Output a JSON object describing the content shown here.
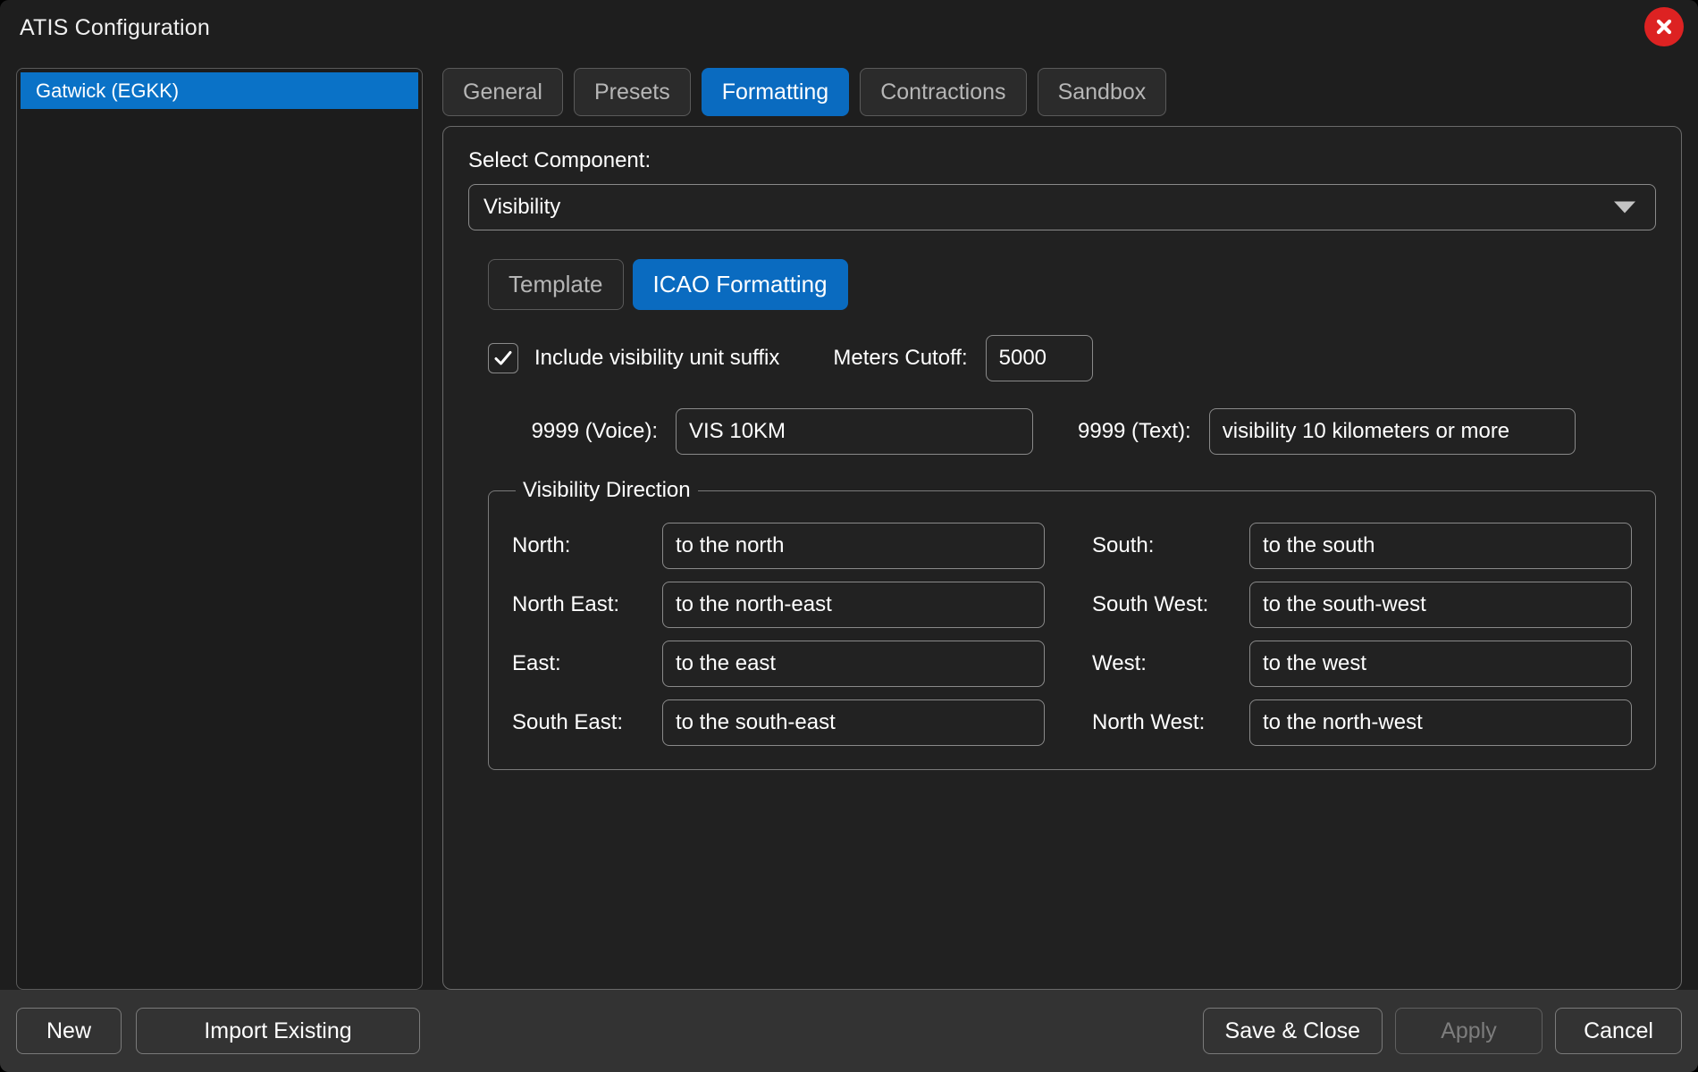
{
  "window": {
    "title": "ATIS Configuration",
    "close_icon": "close-circle-icon"
  },
  "sidebar": {
    "profiles": [
      {
        "label": "Gatwick (EGKK)",
        "selected": true
      }
    ]
  },
  "tabs": [
    {
      "label": "General",
      "active": false
    },
    {
      "label": "Presets",
      "active": false
    },
    {
      "label": "Formatting",
      "active": true
    },
    {
      "label": "Contractions",
      "active": false
    },
    {
      "label": "Sandbox",
      "active": false
    }
  ],
  "formatting": {
    "select_component_label": "Select Component:",
    "selected_component": "Visibility",
    "dropdown_icon": "chevron-down-icon",
    "mode_buttons": [
      {
        "label": "Template",
        "active": false
      },
      {
        "label": "ICAO Formatting",
        "active": true
      }
    ],
    "include_suffix": {
      "label": "Include visibility unit suffix",
      "checked": true,
      "check_icon": "checkmark-icon"
    },
    "meters_cutoff": {
      "label": "Meters Cutoff:",
      "value": "5000",
      "placeholder": ""
    },
    "nines_voice": {
      "label": "9999 (Voice):",
      "value": "VIS 10KM",
      "placeholder": ""
    },
    "nines_text": {
      "label": "9999 (Text):",
      "value": "visibility 10 kilometers or more",
      "placeholder": ""
    },
    "visibility_direction": {
      "legend": "Visibility Direction",
      "rows": [
        {
          "left_label": "North:",
          "left_value": "to the north",
          "right_label": "South:",
          "right_value": "to the south"
        },
        {
          "left_label": "North East:",
          "left_value": "to the north-east",
          "right_label": "South West:",
          "right_value": "to the south-west"
        },
        {
          "left_label": "East:",
          "left_value": "to the east",
          "right_label": "West:",
          "right_value": "to the west"
        },
        {
          "left_label": "South East:",
          "left_value": "to the south-east",
          "right_label": "North West:",
          "right_value": "to the north-west"
        }
      ]
    }
  },
  "footer": {
    "new_label": "New",
    "import_label": "Import Existing",
    "save_close_label": "Save & Close",
    "apply_label": "Apply",
    "apply_disabled": true,
    "cancel_label": "Cancel"
  },
  "colors": {
    "accent_blue": "#0a6bc0",
    "selection_blue": "#0a72c7",
    "close_red": "#dd2222",
    "window_bg": "#1e1e1e",
    "panel_bg": "#212121",
    "bottom_bar": "#333333"
  }
}
